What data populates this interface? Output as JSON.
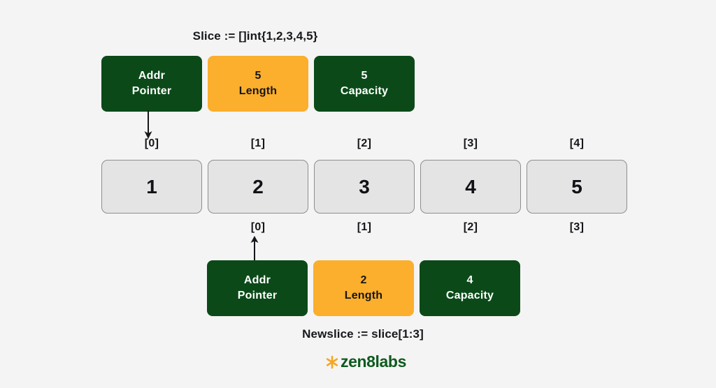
{
  "colors": {
    "background": "#f4f4f4",
    "green": "#0b4a18",
    "orange": "#fbaf2c",
    "cell_fill": "#e4e4e4",
    "cell_border": "#8e8e8e",
    "text_dark": "#15161a",
    "logo_green": "#0e5a1e",
    "logo_orange": "#f5a623"
  },
  "title_caption": "Slice := []int{1,2,3,4,5}",
  "bottom_caption": "Newslice := slice[1:3]",
  "slice_header": {
    "boxes": [
      {
        "value": "Addr",
        "label": "Pointer",
        "style": "green"
      },
      {
        "value": "5",
        "label": "Length",
        "style": "orange"
      },
      {
        "value": "5",
        "label": "Capacity",
        "style": "green"
      }
    ]
  },
  "newslice_header": {
    "boxes": [
      {
        "value": "Addr",
        "label": "Pointer",
        "style": "green"
      },
      {
        "value": "2",
        "label": "Length",
        "style": "orange"
      },
      {
        "value": "4",
        "label": "Capacity",
        "style": "green"
      }
    ]
  },
  "array": {
    "top_indices": [
      "[0]",
      "[1]",
      "[2]",
      "[3]",
      "[4]"
    ],
    "values": [
      "1",
      "2",
      "3",
      "4",
      "5"
    ],
    "bottom_indices": [
      "[0]",
      "[1]",
      "[2]",
      "[3]"
    ]
  },
  "arrows": {
    "slice_pointer": "down-arrow",
    "newslice_pointer": "up-arrow"
  },
  "logo": {
    "text": "zen8labs",
    "mark": "asterisk-icon"
  }
}
